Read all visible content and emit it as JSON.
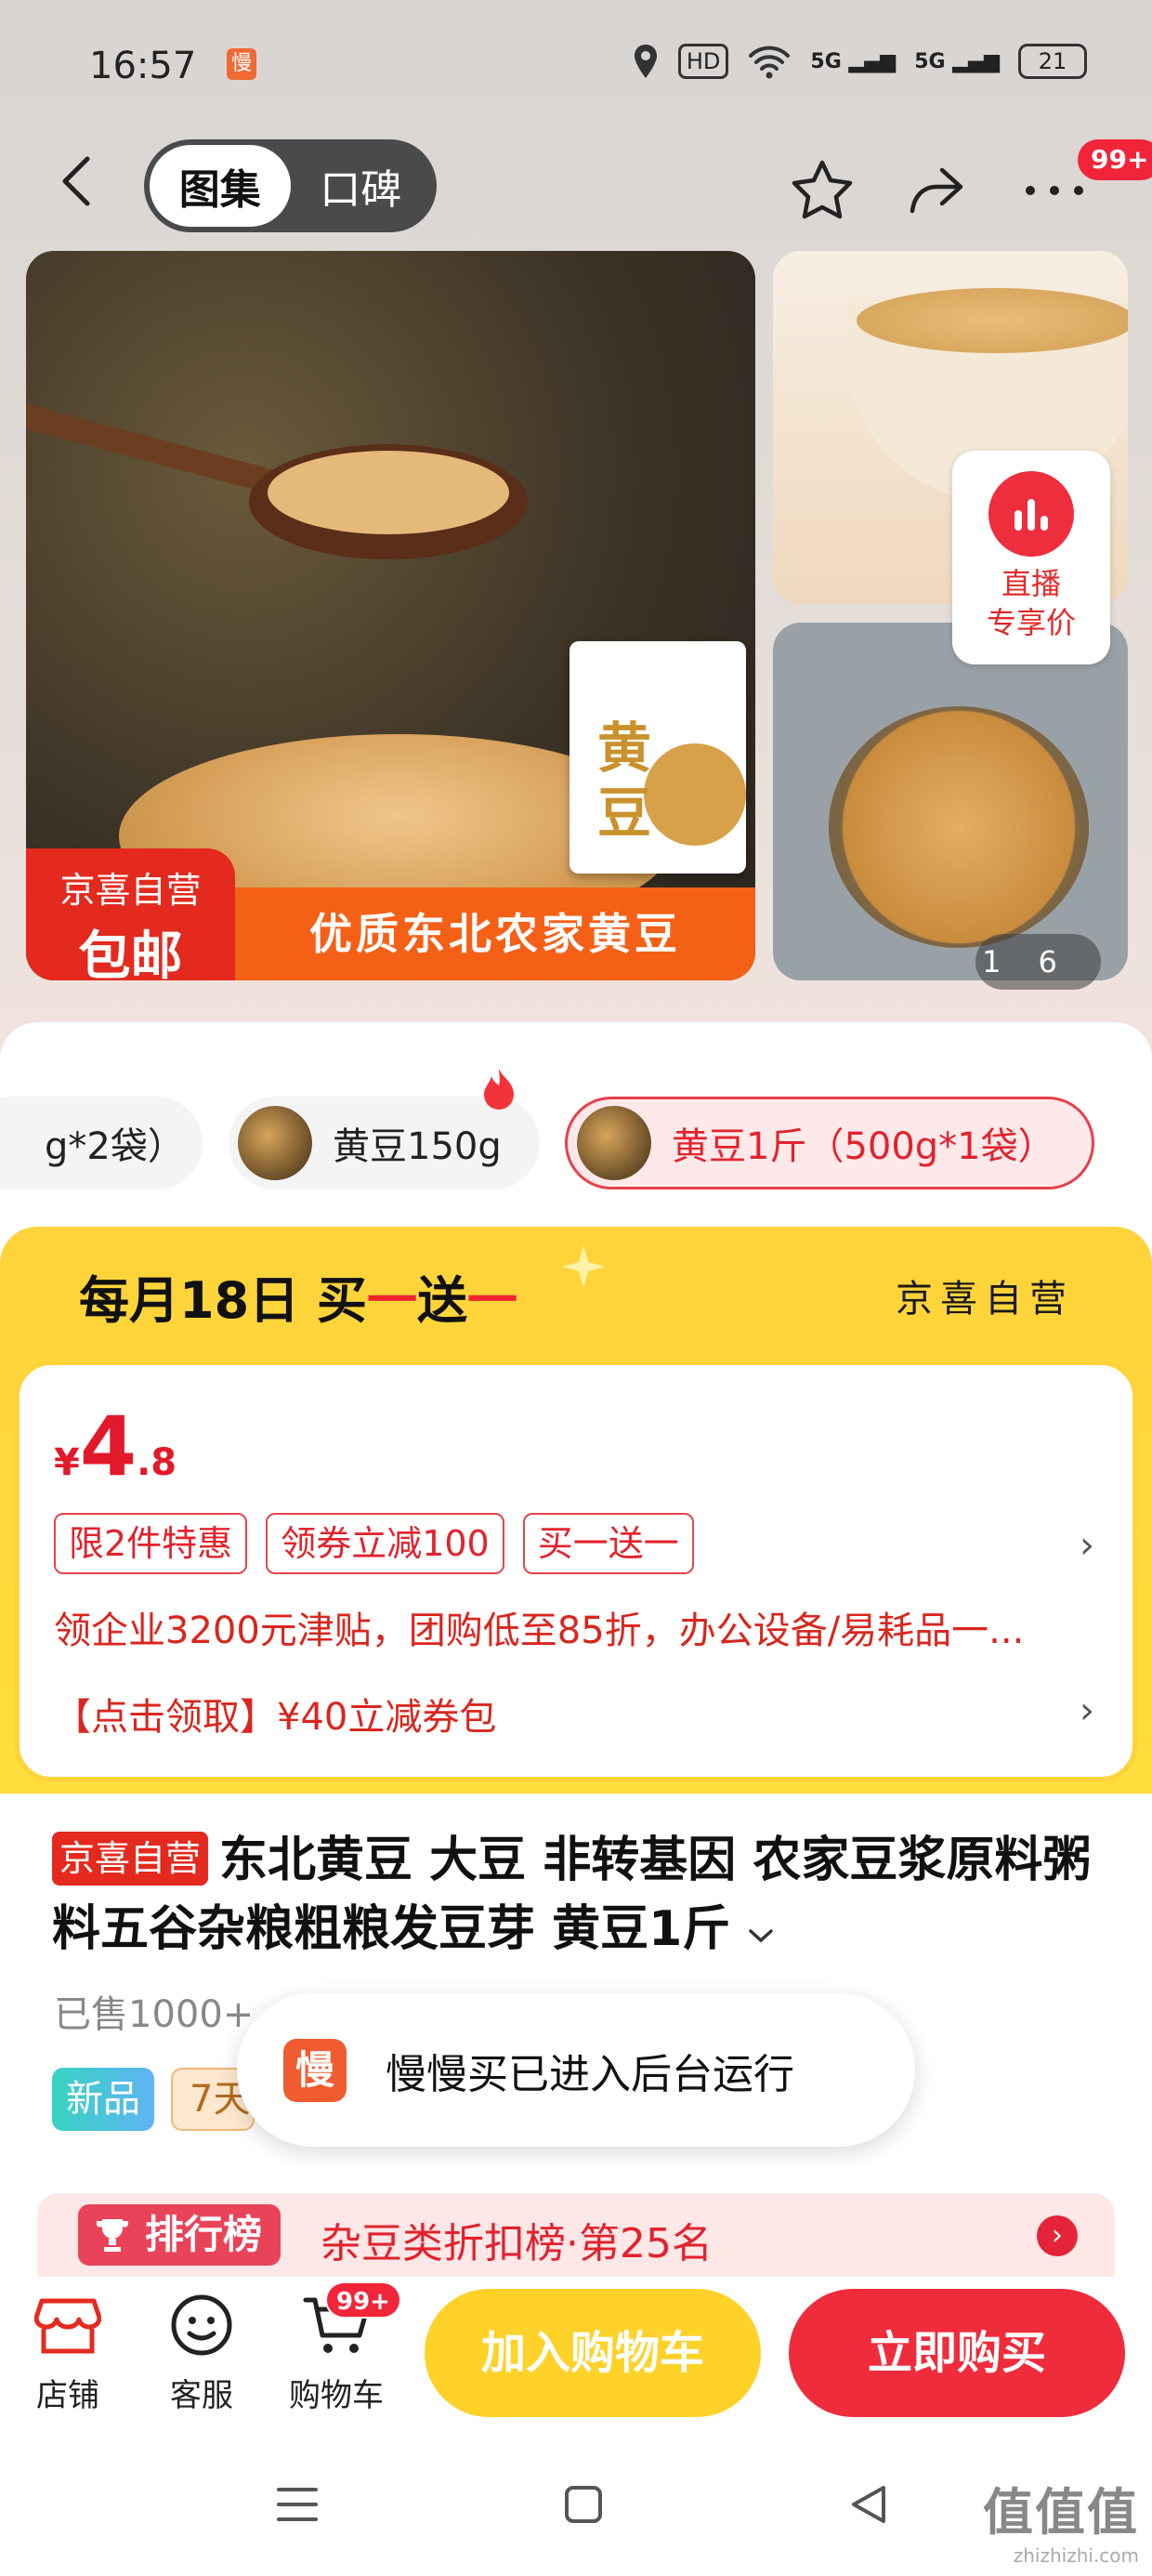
{
  "status_bar": {
    "time": "16:57",
    "app_icon": "慢",
    "hd_label": "HD",
    "signal_a": "5G",
    "signal_b": "5G",
    "battery": "21"
  },
  "nav": {
    "tabs": [
      {
        "label": "图集",
        "active": true
      },
      {
        "label": "口碑",
        "active": false
      }
    ],
    "more_badge": "99+"
  },
  "gallery": {
    "main_promo_line1": "京喜自营",
    "main_promo_line2": "包邮",
    "main_promo_banner": "优质东北农家黄豆",
    "package_text": "黄豆",
    "live_label_line1": "直播",
    "live_label_line2": "专享价",
    "counter_current": "1",
    "counter_total": "6"
  },
  "skus": [
    {
      "label": "g*2袋）",
      "active": false
    },
    {
      "label": "黄豆150g",
      "active": false
    },
    {
      "label": "黄豆1斤（500g*1袋）",
      "active": true
    }
  ],
  "promo": {
    "title_prefix": "每月18日 买",
    "title_one_a": "一",
    "title_send": "送",
    "title_one_b": "一",
    "seller": "京喜自营",
    "price_symbol": "¥",
    "price_int": "4",
    "price_dec": ".8",
    "tags": [
      "限2件特惠",
      "领券立减100",
      "买一送一"
    ],
    "subsidy": "领企业3200元津贴，团购低至85折，办公设备/易耗品一...",
    "coupon": "【点击领取】¥40立减券包"
  },
  "product": {
    "badge": "京喜自营",
    "title": "东北黄豆 大豆 非转基因 农家豆浆原料粥料五谷杂粮粗粮发豆芽 黄豆1斤",
    "sold": "已售1000+",
    "tag_new": "新品",
    "tag_seven": "7天"
  },
  "toast": {
    "logo": "慢",
    "text": "慢慢买已进入后台运行"
  },
  "rank": {
    "badge": "排行榜",
    "text": "杂豆类折扣榜·第25名"
  },
  "bottom": {
    "shop": "店铺",
    "service": "客服",
    "cart": "购物车",
    "cart_badge": "99+",
    "add_to_cart": "加入购物车",
    "buy_now": "立即购买"
  },
  "watermark": {
    "main": "值值值",
    "sub": "zhizhizhi.com"
  },
  "colors": {
    "accent_red": "#ef2c3c",
    "accent_yellow": "#ffd22a",
    "promo_orange": "#f56017"
  }
}
